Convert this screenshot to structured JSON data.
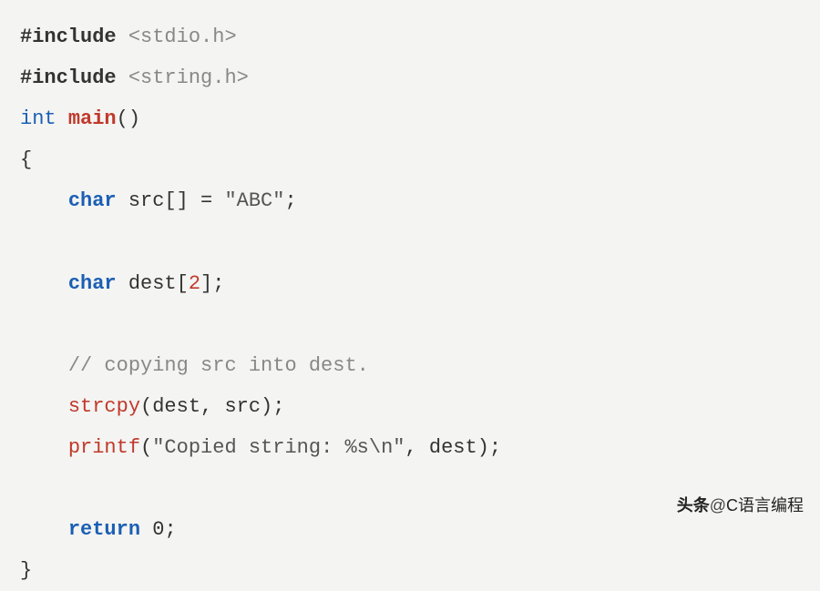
{
  "code": {
    "l1_preproc": "#include",
    "l1_inc": "<stdio.h>",
    "l2_preproc": "#include",
    "l2_inc": "<string.h>",
    "l3_int": "int",
    "l3_main": "main",
    "l3_parens": "()",
    "l4_brace": "{",
    "l5_char": "char",
    "l5_rest": " src[] = ",
    "l5_str": "\"ABC\"",
    "l5_semi": ";",
    "l7_char": "char",
    "l7_dest": " dest[",
    "l7_num": "2",
    "l7_end": "];",
    "l9_comment": "// copying src into dest.",
    "l10_fn": "strcpy",
    "l10_args": "(dest, src);",
    "l11_fn": "printf",
    "l11_open": "(",
    "l11_str": "\"Copied string: %s\\n\"",
    "l11_rest": ", dest);",
    "l13_return": "return",
    "l13_val": " 0",
    "l13_semi": ";",
    "l14_brace": "}"
  },
  "watermark": {
    "prefix": "头条",
    "at": "@",
    "name": "C语言编程"
  }
}
